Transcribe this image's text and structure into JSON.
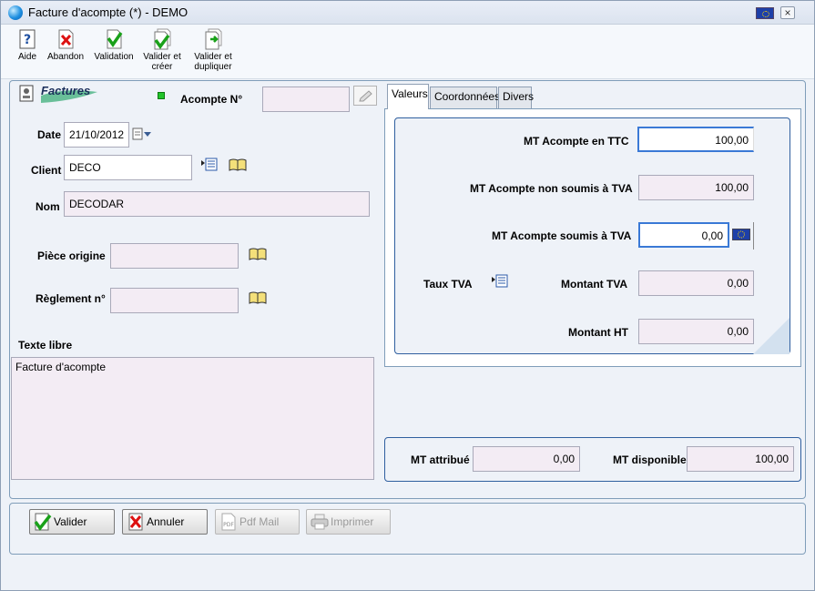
{
  "window": {
    "title": "Facture d'acompte (*)  - DEMO"
  },
  "toolbar": {
    "aide": "Aide",
    "abandon": "Abandon",
    "validation": "Validation",
    "valider_creer": [
      "Valider et",
      "créer"
    ],
    "valider_dupliquer": [
      "Valider et",
      "dupliquer"
    ]
  },
  "form": {
    "section_title": "Factures",
    "acompte_label": "Acompte N°",
    "acompte_value": "",
    "date_label": "Date",
    "date_value": "21/10/2012",
    "client_label": "Client",
    "client_value": "DECO",
    "nom_label": "Nom",
    "nom_value": "DECODAR",
    "piece_label": "Pièce origine",
    "piece_value": "",
    "reglement_label": "Règlement n°",
    "reglement_value": "",
    "texte_libre_label": "Texte libre",
    "texte_libre_value": "Facture d'acompte"
  },
  "tabs": [
    "Valeurs",
    "Coordonnées",
    "Divers"
  ],
  "values": {
    "mt_ttc_label": "MT Acompte en TTC",
    "mt_ttc_value": "100,00",
    "mt_non_soumis_label": "MT Acompte non soumis à TVA",
    "mt_non_soumis_value": "100,00",
    "mt_soumis_label": "MT Acompte soumis à TVA",
    "mt_soumis_value": "0,00",
    "taux_tva_label": "Taux TVA",
    "montant_tva_label": "Montant TVA",
    "montant_tva_value": "0,00",
    "montant_ht_label": "Montant HT",
    "montant_ht_value": "0,00"
  },
  "totals": {
    "attribue_label": "MT attribué",
    "attribue_value": "0,00",
    "disponible_label": "MT disponible",
    "disponible_value": "100,00"
  },
  "buttons": {
    "valider": "Valider",
    "annuler": "Annuler",
    "pdf_mail": "Pdf Mail",
    "imprimer": "Imprimer"
  }
}
